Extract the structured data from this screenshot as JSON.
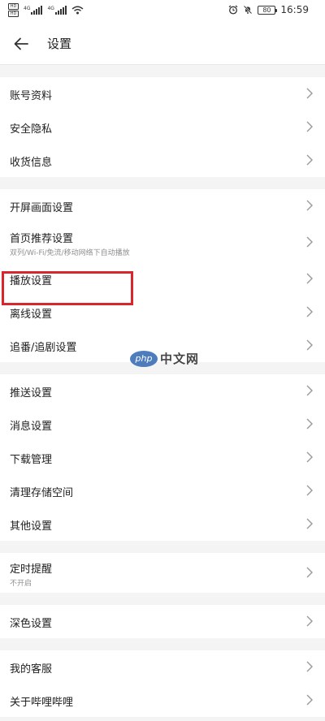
{
  "status_bar": {
    "sim1": "HD",
    "sim2": "HD",
    "net1": "4G",
    "net2": "4G",
    "battery": "80",
    "time": "16:59"
  },
  "header": {
    "title": "设置"
  },
  "groups": [
    {
      "items": [
        {
          "label": "账号资料"
        },
        {
          "label": "安全隐私"
        },
        {
          "label": "收货信息"
        }
      ]
    },
    {
      "items": [
        {
          "label": "开屏画面设置"
        },
        {
          "label": "首页推荐设置",
          "sub": "双列/Wi-Fi/免流/移动网络下自动播放"
        },
        {
          "label": "播放设置"
        },
        {
          "label": "离线设置"
        },
        {
          "label": "追番/追剧设置"
        }
      ]
    },
    {
      "items": [
        {
          "label": "推送设置"
        },
        {
          "label": "消息设置"
        },
        {
          "label": "下载管理"
        },
        {
          "label": "清理存储空间"
        },
        {
          "label": "其他设置"
        }
      ]
    },
    {
      "items": [
        {
          "label": "定时提醒",
          "sub": "不开启"
        }
      ]
    },
    {
      "items": [
        {
          "label": "深色设置"
        }
      ]
    },
    {
      "items": [
        {
          "label": "我的客服"
        },
        {
          "label": "关于哔哩哔哩"
        }
      ]
    }
  ],
  "watermark": {
    "logo": "php",
    "text": "中文网"
  },
  "colors": {
    "highlight": "#d8262c",
    "background": "#f4f4f4"
  }
}
